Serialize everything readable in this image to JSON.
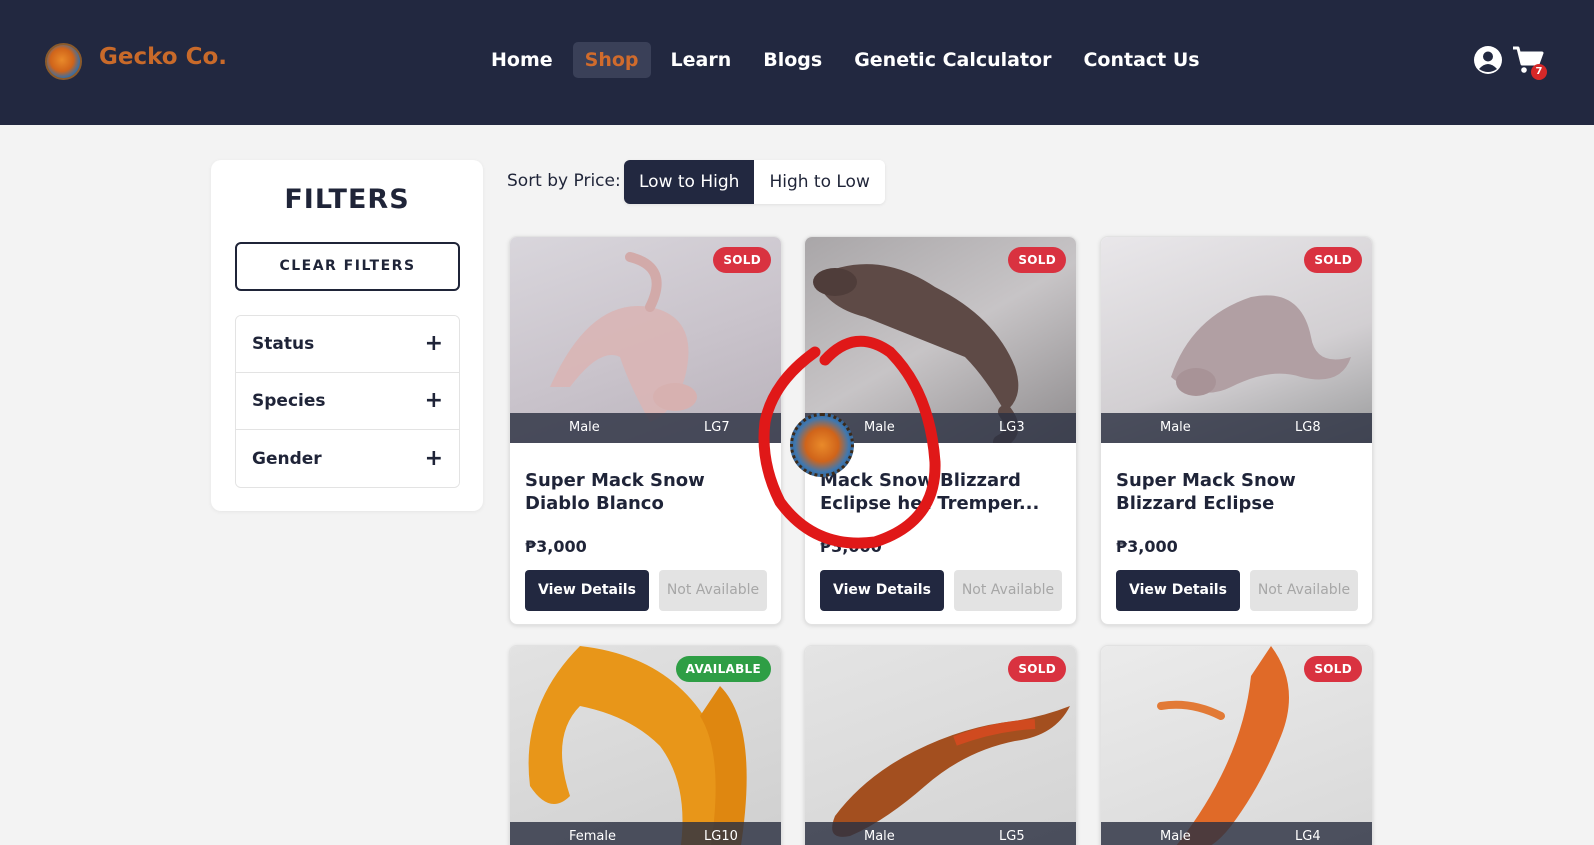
{
  "brand": {
    "name": "Gecko Co.",
    "logo_icon": "gecko-logo-icon"
  },
  "nav": {
    "items": [
      {
        "label": "Home",
        "active": false
      },
      {
        "label": "Shop",
        "active": true
      },
      {
        "label": "Learn",
        "active": false
      },
      {
        "label": "Blogs",
        "active": false
      },
      {
        "label": "Genetic Calculator",
        "active": false
      },
      {
        "label": "Contact Us",
        "active": false
      }
    ],
    "cart_count": "7"
  },
  "filters": {
    "title": "FILTERS",
    "clear_label": "CLEAR FILTERS",
    "groups": [
      {
        "label": "Status",
        "toggle": "+"
      },
      {
        "label": "Species",
        "toggle": "+"
      },
      {
        "label": "Gender",
        "toggle": "+"
      }
    ]
  },
  "sort": {
    "label": "Sort by Price:",
    "options": [
      {
        "label": "Low to High",
        "active": true
      },
      {
        "label": "High to Low",
        "active": false
      }
    ]
  },
  "products": [
    {
      "status": "SOLD",
      "gender": "Male",
      "code": "LG7",
      "title": "Super Mack Snow Diablo Blanco",
      "price": "₱3,000",
      "view_label": "View Details",
      "avail_label": "Not Available"
    },
    {
      "status": "SOLD",
      "gender": "Male",
      "code": "LG3",
      "title": "Mack Snow Blizzard Eclipse het Tremper...",
      "price": "₱3,000",
      "view_label": "View Details",
      "avail_label": "Not Available"
    },
    {
      "status": "SOLD",
      "gender": "Male",
      "code": "LG8",
      "title": "Super Mack Snow Blizzard Eclipse",
      "price": "₱3,000",
      "view_label": "View Details",
      "avail_label": "Not Available"
    },
    {
      "status": "AVAILABLE",
      "gender": "Female",
      "code": "LG10"
    },
    {
      "status": "SOLD",
      "gender": "Male",
      "code": "LG5"
    },
    {
      "status": "SOLD",
      "gender": "Male",
      "code": "LG4"
    }
  ],
  "colors": {
    "navbar": "#222840",
    "accent": "#c96a2a",
    "sold": "#d93240",
    "available": "#2e9e45",
    "annotation": "#e01818"
  }
}
